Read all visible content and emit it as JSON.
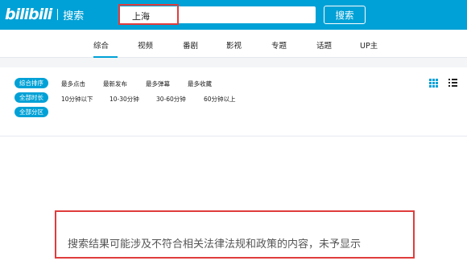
{
  "header": {
    "logo_mark": "bilibili",
    "logo_text": "搜索",
    "search_value": "上海",
    "search_button": "搜索",
    "brand_color": "#00a1d6"
  },
  "tabs": [
    "综合",
    "视频",
    "番剧",
    "影视",
    "专题",
    "话题",
    "UP主"
  ],
  "active_tab": "综合",
  "filters": {
    "order": {
      "label": "综合排序",
      "options": [
        "最多点击",
        "最新发布",
        "最多弹幕",
        "最多收藏"
      ]
    },
    "duration": {
      "label": "全部时长",
      "options": [
        "10分钟以下",
        "10-30分钟",
        "30-60分钟",
        "60分钟以上"
      ]
    },
    "zone": {
      "label": "全部分区"
    }
  },
  "view_icons": [
    "grid-view-icon",
    "list-view-icon"
  ],
  "notice": "搜索结果可能涉及不符合相关法律法规和政策的内容，未予显示"
}
